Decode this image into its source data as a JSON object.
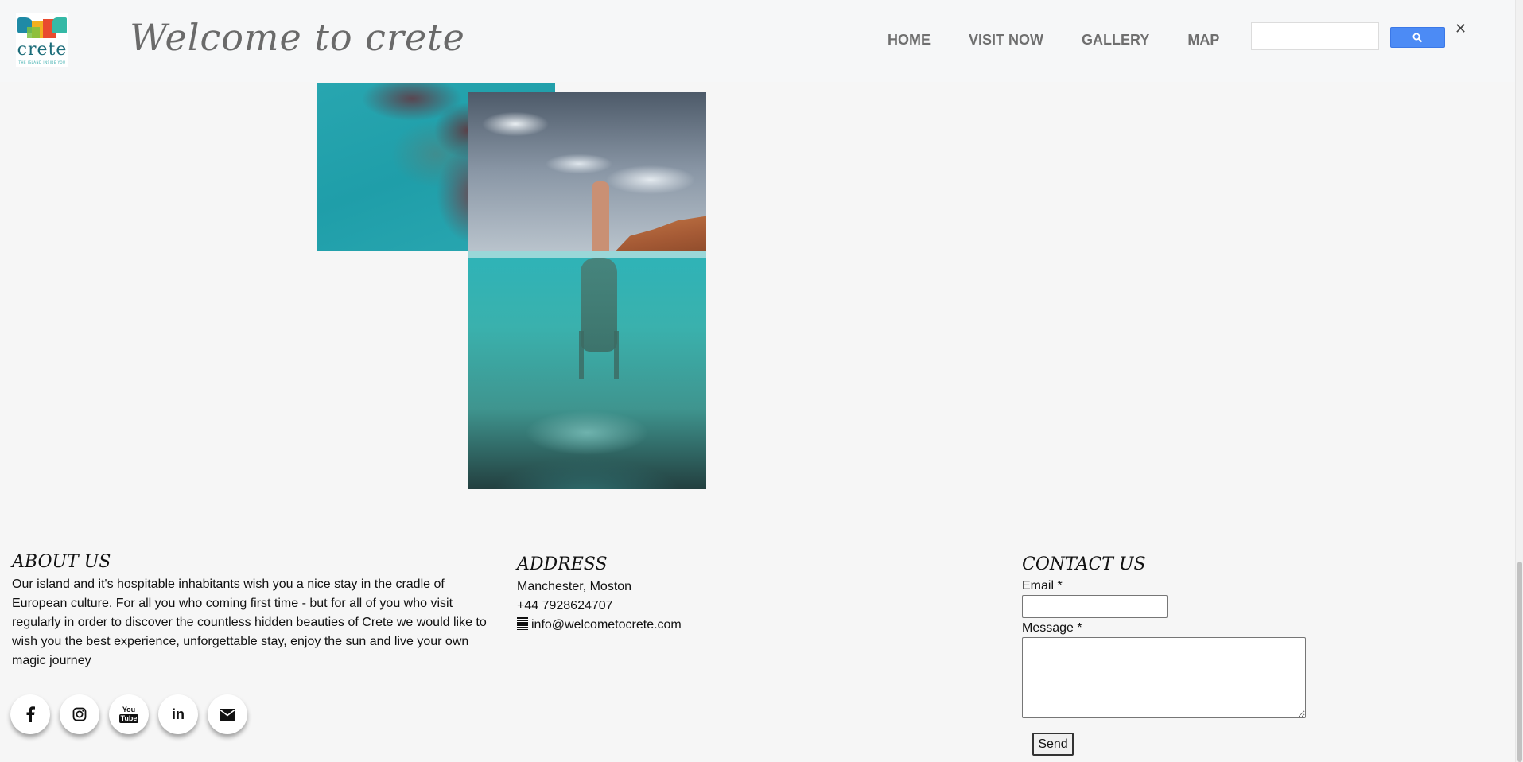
{
  "header": {
    "logo_text": "crete",
    "logo_tagline": "THE ISLAND INSIDE YOU",
    "site_title": "Welcome to crete",
    "nav": [
      {
        "label": "HOME"
      },
      {
        "label": "VISIT NOW"
      },
      {
        "label": "GALLERY"
      },
      {
        "label": "MAP"
      }
    ],
    "search": {
      "value": "",
      "placeholder": "",
      "button_icon": "search-icon"
    },
    "close_icon": "✕"
  },
  "gallery": {
    "images": [
      {
        "name": "turquoise-sea-aerial-photo"
      },
      {
        "name": "underwater-handstand-photo"
      }
    ]
  },
  "footer": {
    "about": {
      "heading": "ABOUT US",
      "text": "Our island and it's hospitable inhabitants wish you a nice stay in the cradle of European culture. For all you who coming first time - but for all of you who visit regularly in order to discover the countless hidden beauties of Crete we would like to wish you the best experience, unforgettable stay, enjoy the sun and live your own magic journey"
    },
    "social": [
      {
        "icon": "facebook-icon",
        "glyph": "f"
      },
      {
        "icon": "instagram-icon",
        "glyph": "◎"
      },
      {
        "icon": "youtube-icon",
        "glyph": "You\nTube"
      },
      {
        "icon": "linkedin-icon",
        "glyph": "in"
      },
      {
        "icon": "envelope-icon",
        "glyph": "✉"
      }
    ],
    "address": {
      "heading": "ADDRESS",
      "city": "Manchester, Moston",
      "phone": "+44 7928624707",
      "email_icon": "𝄛",
      "email": "info@welcometocrete.com"
    },
    "contact": {
      "heading": "CONTACT US",
      "email_label": "Email *",
      "email_value": "",
      "message_label": "Message *",
      "message_value": "",
      "send_label": "Send"
    }
  },
  "colors": {
    "background": "#f6f6f6",
    "nav_text": "#6f6f6f",
    "search_button": "#4c8bf5"
  }
}
